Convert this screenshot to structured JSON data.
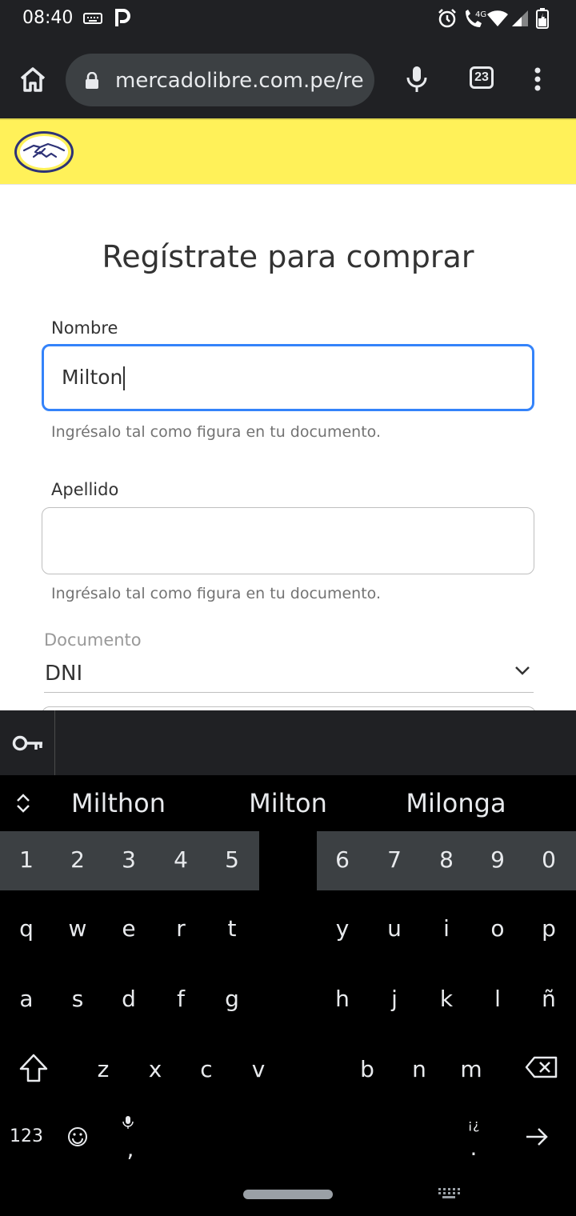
{
  "status_bar": {
    "time": "08:40",
    "icons": [
      "keyboard-icon",
      "parking-icon",
      "alarm-icon",
      "wifi-calling-icon",
      "4g-icon",
      "wifi-icon",
      "signal-icon",
      "battery-icon"
    ]
  },
  "browser": {
    "url": "mercadolibre.com.pe/regi",
    "tab_count": "23"
  },
  "page": {
    "title": "Regístrate para comprar",
    "nombre": {
      "label": "Nombre",
      "value": "Milton",
      "help": "Ingrésalo tal como figura en tu documento."
    },
    "apellido": {
      "label": "Apellido",
      "value": "",
      "help": "Ingrésalo tal como figura en tu documento."
    },
    "documento": {
      "label": "Documento",
      "value": "DNI"
    }
  },
  "keyboard": {
    "suggestions": [
      "Milthon",
      "Milton",
      "Milonga"
    ],
    "number_row": [
      "1",
      "2",
      "3",
      "4",
      "5",
      "6",
      "7",
      "8",
      "9",
      "0"
    ],
    "row1": [
      "q",
      "w",
      "e",
      "r",
      "t",
      "y",
      "u",
      "i",
      "o",
      "p"
    ],
    "row2": [
      "a",
      "s",
      "d",
      "f",
      "g",
      "h",
      "j",
      "k",
      "l",
      "ñ"
    ],
    "row3": [
      "z",
      "x",
      "c",
      "v",
      "b",
      "n",
      "m"
    ],
    "symbols_label": "123",
    "comma": ",",
    "period": ".",
    "alt_punct": "¡¿"
  },
  "colors": {
    "header_yellow": "#fff159",
    "focus_blue": "#3483fa",
    "chrome_dark": "#202124"
  }
}
